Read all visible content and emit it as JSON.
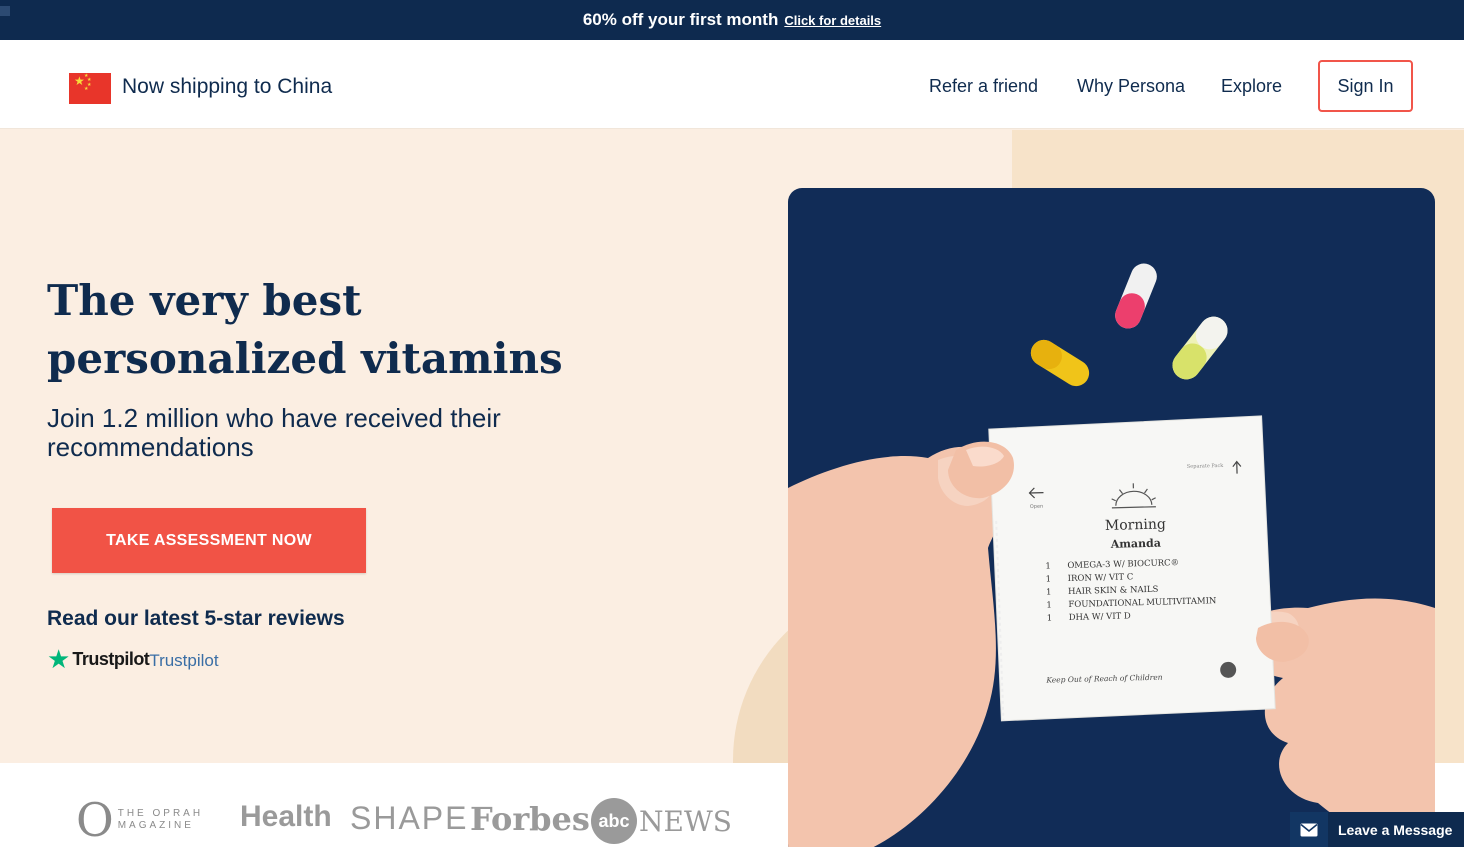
{
  "promo": {
    "text": "60% off your first month",
    "link": "Click for details"
  },
  "nav": {
    "shipping_text": "Now shipping to China",
    "links": [
      "Refer a friend",
      "Why Persona",
      "Explore"
    ],
    "sign_in": "Sign In"
  },
  "hero": {
    "title_line1": "The very best",
    "title_line2": "personalized vitamins",
    "subtitle": "Join 1.2 million who have received their recommendations",
    "cta": "TAKE ASSESSMENT NOW",
    "reviews_heading": "Read our latest 5-star reviews",
    "trustpilot_wordmark": "Trustpilot",
    "trustpilot_link": "Trustpilot"
  },
  "press": {
    "oprah_letter": "O",
    "oprah_text": "THE OPRAH MAGAZINE",
    "health": "Health",
    "shape": "SHAPE",
    "forbes": "Forbes",
    "abc": "abc",
    "news": "NEWS"
  },
  "packet": {
    "time": "Morning",
    "name": "Amanda",
    "open_label": "Open",
    "separate_label": "Separate Pack",
    "items": [
      {
        "qty": "1",
        "label": "OMEGA-3 W/ BIOCURC®"
      },
      {
        "qty": "1",
        "label": "IRON W/ VIT C"
      },
      {
        "qty": "1",
        "label": "HAIR SKIN & NAILS"
      },
      {
        "qty": "1",
        "label": "FOUNDATIONAL MULTIVITAMIN"
      },
      {
        "qty": "1",
        "label": "DHA W/ VIT D"
      }
    ],
    "warning": "Keep Out of Reach of Children"
  },
  "chat": {
    "label": "Leave a Message",
    "icon": "envelope-icon"
  },
  "colors": {
    "navy": "#0e2a4f",
    "coral": "#f15346",
    "cream": "#fbeee2",
    "trustpilot_green": "#00b67a"
  }
}
